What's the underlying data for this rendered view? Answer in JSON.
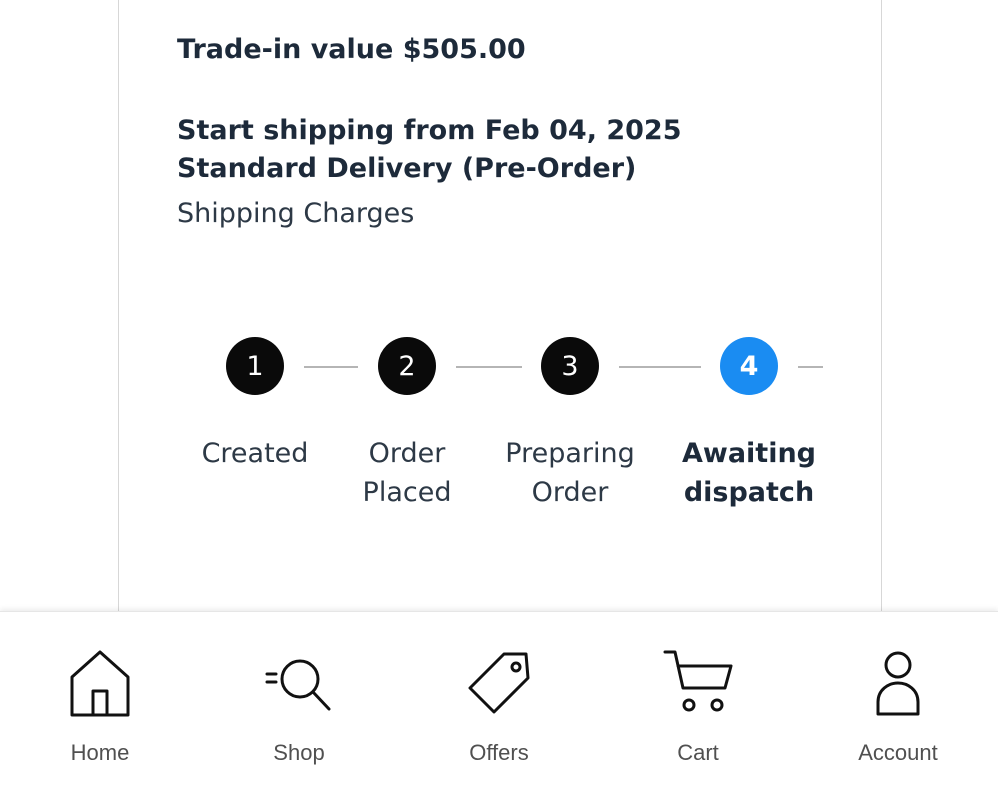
{
  "order": {
    "trade_in": "Trade-in value $505.00",
    "shipping_title": "Start shipping from Feb 04, 2025 Standard Delivery (Pre-Order)",
    "shipping_charges": "Shipping Charges"
  },
  "stepper": {
    "steps": [
      {
        "number": "1",
        "label": "Created"
      },
      {
        "number": "2",
        "label": "Order Placed"
      },
      {
        "number": "3",
        "label": "Preparing Order"
      },
      {
        "number": "4",
        "label": "Awaiting dispatch"
      }
    ],
    "active_step": "4",
    "active_color": "#1a8cf2",
    "complete_color": "#0a0a0a"
  },
  "bottom_nav": {
    "items": [
      {
        "label": "Home",
        "icon": "home-icon"
      },
      {
        "label": "Shop",
        "icon": "search-icon"
      },
      {
        "label": "Offers",
        "icon": "tag-icon"
      },
      {
        "label": "Cart",
        "icon": "cart-icon"
      },
      {
        "label": "Account",
        "icon": "person-icon"
      }
    ]
  }
}
